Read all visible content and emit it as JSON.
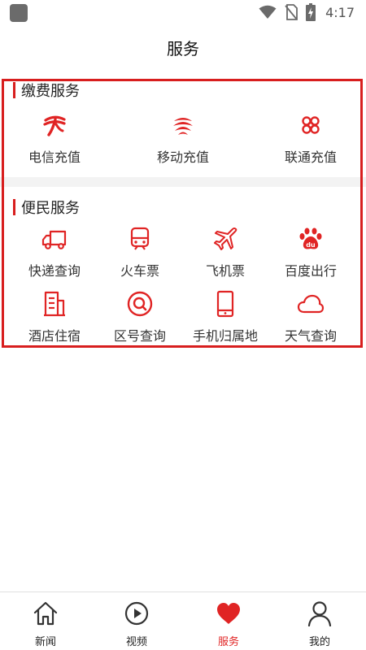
{
  "status_bar": {
    "time": "4:17",
    "icons": [
      "app-icon",
      "wifi-icon",
      "no-sim-icon",
      "battery-charging-icon"
    ]
  },
  "header": {
    "title": "服务"
  },
  "sections": [
    {
      "title": "缴费服务",
      "items": [
        {
          "label": "电信充值",
          "icon": "telecom-logo-icon"
        },
        {
          "label": "移动充值",
          "icon": "mobile-logo-icon"
        },
        {
          "label": "联通充值",
          "icon": "unicom-logo-icon"
        }
      ]
    },
    {
      "title": "便民服务",
      "items": [
        {
          "label": "快递查询",
          "icon": "truck-icon"
        },
        {
          "label": "火车票",
          "icon": "train-icon"
        },
        {
          "label": "飞机票",
          "icon": "plane-icon"
        },
        {
          "label": "百度出行",
          "icon": "baidu-paw-icon"
        },
        {
          "label": "酒店住宿",
          "icon": "building-icon"
        },
        {
          "label": "区号查询",
          "icon": "search-circle-icon"
        },
        {
          "label": "手机归属地",
          "icon": "phone-icon"
        },
        {
          "label": "天气查询",
          "icon": "cloud-icon"
        }
      ]
    }
  ],
  "bottom_nav": [
    {
      "label": "新闻",
      "icon": "home-icon",
      "active": false
    },
    {
      "label": "视频",
      "icon": "play-circle-icon",
      "active": false
    },
    {
      "label": "服务",
      "icon": "heart-icon",
      "active": true
    },
    {
      "label": "我的",
      "icon": "user-icon",
      "active": false
    }
  ],
  "colors": {
    "accent": "#e02424",
    "highlight_border": "#d81e1e",
    "section_gap": "#f3f3f3"
  }
}
